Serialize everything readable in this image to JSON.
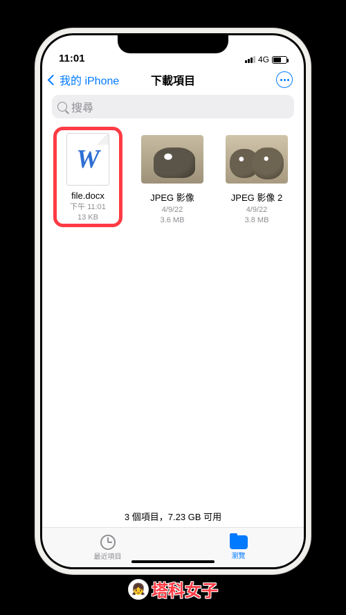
{
  "status": {
    "time": "11:01",
    "network": "4G"
  },
  "nav": {
    "back_label": "我的 iPhone",
    "title": "下載項目"
  },
  "search": {
    "placeholder": "搜尋"
  },
  "files": [
    {
      "name": "file.docx",
      "date": "下午 11:01",
      "size": "13 KB",
      "kind": "word",
      "highlighted": true
    },
    {
      "name": "JPEG 影像",
      "date": "4/9/22",
      "size": "3.6 MB",
      "kind": "image1",
      "highlighted": false
    },
    {
      "name": "JPEG 影像 2",
      "date": "4/9/22",
      "size": "3.8 MB",
      "kind": "image2",
      "highlighted": false
    }
  ],
  "footer_status": "3 個項目，7.23 GB 可用",
  "tabs": {
    "recent": "最近項目",
    "browse": "瀏覽"
  },
  "watermark": "塔科女子"
}
